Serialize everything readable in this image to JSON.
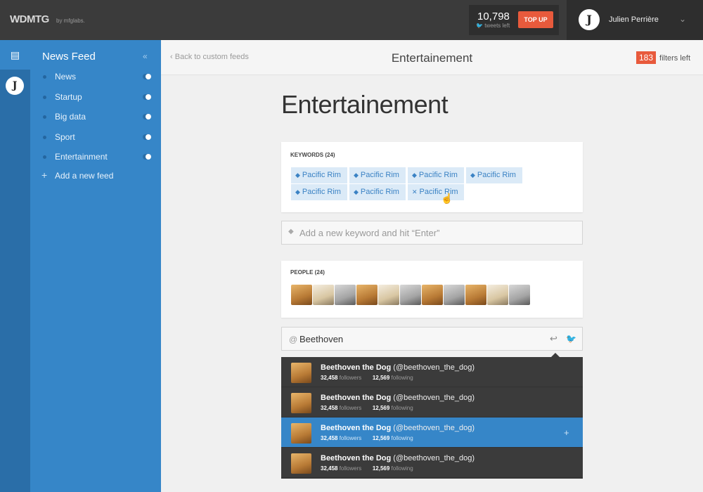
{
  "topbar": {
    "logo": "WDMTG",
    "logo_by": "by mfglabs.",
    "tweets_count": "10,798",
    "tweets_sub": "tweets left",
    "topup_label": "TOP UP",
    "user_initial": "J",
    "user_name": "Julien Perrière"
  },
  "sidebar": {
    "title": "News Feed",
    "items": [
      {
        "label": "News"
      },
      {
        "label": "Startup"
      },
      {
        "label": "Big data"
      },
      {
        "label": "Sport"
      },
      {
        "label": "Entertainment"
      }
    ],
    "add_label": "Add a new feed"
  },
  "header": {
    "back_label": "Back to custom feeds",
    "title": "Entertainement",
    "filters_count": "183",
    "filters_label": "filters left"
  },
  "main": {
    "title": "Entertainement",
    "keywords_label": "KEYWORDS (24)",
    "keywords": [
      "Pacific Rim",
      "Pacific Rim",
      "Pacific Rim",
      "Pacific Rim",
      "Pacific Rim",
      "Pacific Rim",
      "Pacific Rim"
    ],
    "keyword_placeholder": "Add a new keyword and hit “Enter”",
    "people_label": "PEOPLE (24)",
    "search_value": "Beethoven",
    "results": [
      {
        "name": "Beethoven the Dog",
        "handle": "(@beethoven_the_dog)",
        "followers": "32,458",
        "followers_label": "followers",
        "following": "12,569",
        "following_label": "following"
      },
      {
        "name": "Beethoven the Dog",
        "handle": "(@beethoven_the_dog)",
        "followers": "32,458",
        "followers_label": "followers",
        "following": "12,569",
        "following_label": "following"
      },
      {
        "name": "Beethoven the Dog",
        "handle": "(@beethoven_the_dog)",
        "followers": "32,458",
        "followers_label": "followers",
        "following": "12,569",
        "following_label": "following"
      },
      {
        "name": "Beethoven the Dog",
        "handle": "(@beethoven_the_dog)",
        "followers": "32,458",
        "followers_label": "followers",
        "following": "12,569",
        "following_label": "following"
      }
    ]
  },
  "colors": {
    "accent_blue": "#3686c8",
    "accent_orange": "#e85a3c",
    "dark_bar": "#3b3b3b"
  }
}
